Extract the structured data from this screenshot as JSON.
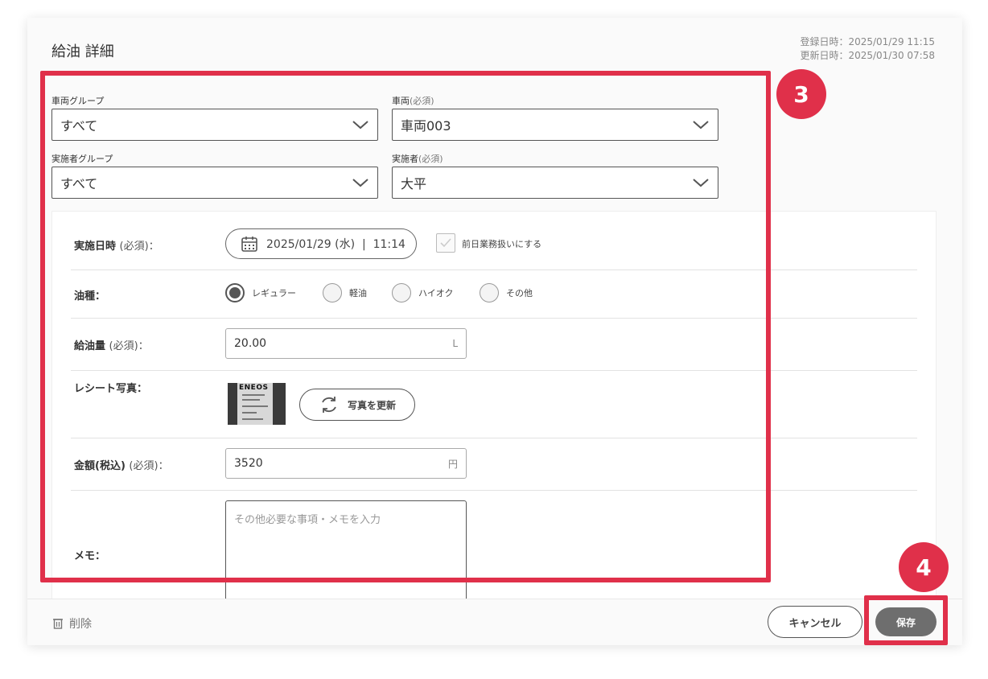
{
  "header": {
    "title": "給油 詳細",
    "created": "登録日時：2025/01/29 11:15",
    "updated": "更新日時：2025/01/30 07:58"
  },
  "top_fields": {
    "vehicle_group": {
      "label": "車両グループ",
      "value": "すべて"
    },
    "vehicle": {
      "label": "車両",
      "required": "(必須)",
      "value": "車両003"
    },
    "executor_group": {
      "label": "実施者グループ",
      "value": "すべて"
    },
    "executor": {
      "label": "実施者",
      "required": "(必須)",
      "value": "大平"
    }
  },
  "form": {
    "datetime": {
      "label": "実施日時",
      "required": "(必須)：",
      "value": "2025/01/29 (水)  |  11:14",
      "prev_day_label": "前日業務扱いにする"
    },
    "fuel_type": {
      "label": "油種：",
      "options": [
        "レギュラー",
        "軽油",
        "ハイオク",
        "その他"
      ],
      "selected": "レギュラー"
    },
    "amount": {
      "label": "給油量",
      "required": "(必須)：",
      "value": "20.00",
      "unit": "L"
    },
    "receipt": {
      "label": "レシート写真：",
      "brand_text": "ENEOS",
      "update_label": "写真を更新"
    },
    "price": {
      "label": "金額(税込)",
      "required": "(必須)：",
      "value": "3520",
      "unit": "円"
    },
    "memo": {
      "label": "メモ：",
      "placeholder": "その他必要な事項・メモを入力"
    }
  },
  "footer": {
    "delete_label": "削除",
    "cancel_label": "キャンセル",
    "save_label": "保存"
  },
  "annotations": {
    "step3": "3",
    "step4": "4",
    "highlight_color": "#e0304a"
  }
}
